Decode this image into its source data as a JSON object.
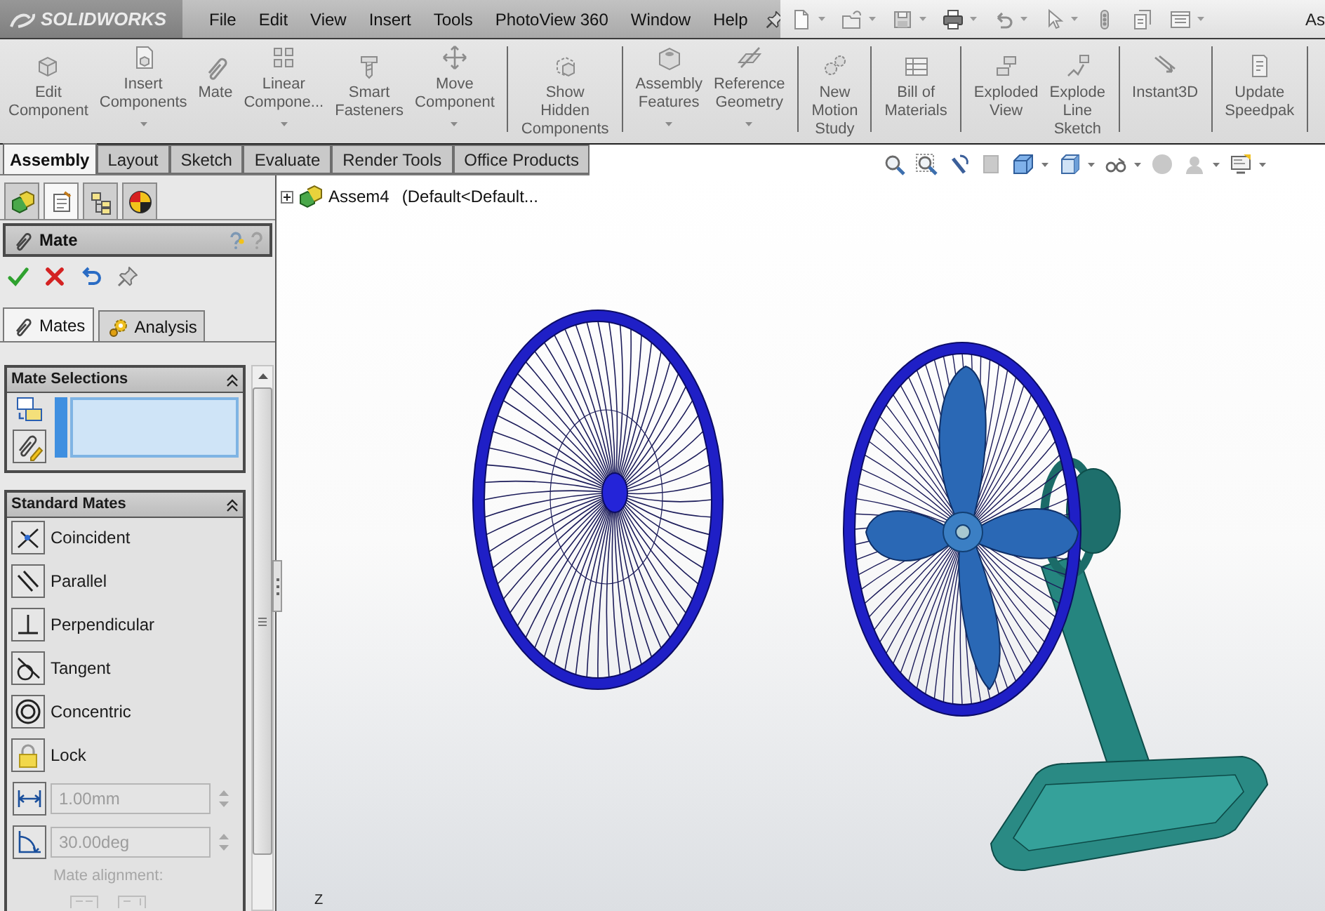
{
  "window": {
    "title": "As"
  },
  "logo": {
    "text": "SOLIDWORKS"
  },
  "menu": [
    "File",
    "Edit",
    "View",
    "Insert",
    "Tools",
    "PhotoView 360",
    "Window",
    "Help"
  ],
  "ribbon": {
    "groups": [
      {
        "buttons": [
          {
            "label": "Edit\nComponent",
            "dropdown": false
          },
          {
            "label": "Insert\nComponents",
            "dropdown": true
          },
          {
            "label": "Mate",
            "dropdown": false
          },
          {
            "label": "Linear\nCompone...",
            "dropdown": true
          },
          {
            "label": "Smart\nFasteners",
            "dropdown": false
          },
          {
            "label": "Move\nComponent",
            "dropdown": true
          }
        ]
      },
      {
        "buttons": [
          {
            "label": "Show\nHidden\nComponents",
            "dropdown": false
          }
        ]
      },
      {
        "buttons": [
          {
            "label": "Assembly\nFeatures",
            "dropdown": true
          },
          {
            "label": "Reference\nGeometry",
            "dropdown": true
          }
        ]
      },
      {
        "buttons": [
          {
            "label": "New\nMotion\nStudy",
            "dropdown": false
          }
        ]
      },
      {
        "buttons": [
          {
            "label": "Bill of\nMaterials",
            "dropdown": false
          }
        ]
      },
      {
        "buttons": [
          {
            "label": "Exploded\nView",
            "dropdown": false
          },
          {
            "label": "Explode\nLine\nSketch",
            "dropdown": false
          }
        ]
      },
      {
        "buttons": [
          {
            "label": "Instant3D",
            "dropdown": false
          }
        ]
      },
      {
        "buttons": [
          {
            "label": "Update\nSpeedpak",
            "dropdown": false
          }
        ]
      }
    ]
  },
  "tabs": [
    {
      "label": "Assembly",
      "selected": true
    },
    {
      "label": "Layout",
      "selected": false
    },
    {
      "label": "Sketch",
      "selected": false
    },
    {
      "label": "Evaluate",
      "selected": false
    },
    {
      "label": "Render Tools",
      "selected": false
    },
    {
      "label": "Office Products",
      "selected": false
    }
  ],
  "manager_tabs": [
    {
      "selected": false
    },
    {
      "selected": true
    },
    {
      "selected": false
    },
    {
      "selected": false
    }
  ],
  "property_manager": {
    "title": "Mate",
    "mode_tabs": [
      {
        "label": "Mates",
        "selected": true
      },
      {
        "label": "Analysis",
        "selected": false
      }
    ],
    "mate_selections": {
      "title": "Mate Selections",
      "expanded": true
    },
    "standard_mates": {
      "title": "Standard Mates",
      "expanded": true,
      "types": [
        "Coincident",
        "Parallel",
        "Perpendicular",
        "Tangent",
        "Concentric",
        "Lock"
      ],
      "distance": {
        "value": "1.00mm",
        "disabled": true
      },
      "angle": {
        "value": "30.00deg",
        "disabled": true
      },
      "alignment": {
        "label": "Mate alignment:",
        "disabled": true
      }
    }
  },
  "graphics_area": {
    "tree_item": {
      "expanded": false,
      "name": "Assem4",
      "configuration": "(Default<Default..."
    },
    "triad_label": "Z"
  }
}
